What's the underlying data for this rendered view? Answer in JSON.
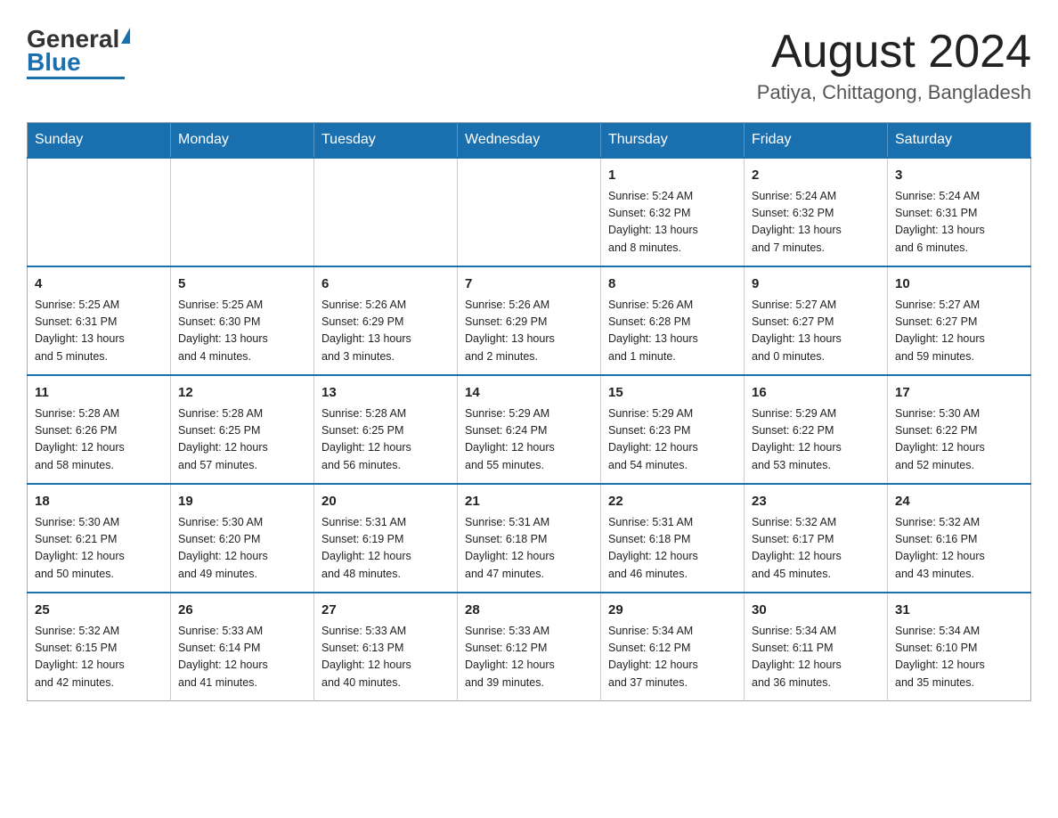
{
  "header": {
    "logo_general": "General",
    "logo_blue": "Blue",
    "month_title": "August 2024",
    "location": "Patiya, Chittagong, Bangladesh"
  },
  "weekdays": [
    "Sunday",
    "Monday",
    "Tuesday",
    "Wednesday",
    "Thursday",
    "Friday",
    "Saturday"
  ],
  "weeks": [
    [
      {
        "day": "",
        "info": ""
      },
      {
        "day": "",
        "info": ""
      },
      {
        "day": "",
        "info": ""
      },
      {
        "day": "",
        "info": ""
      },
      {
        "day": "1",
        "info": "Sunrise: 5:24 AM\nSunset: 6:32 PM\nDaylight: 13 hours\nand 8 minutes."
      },
      {
        "day": "2",
        "info": "Sunrise: 5:24 AM\nSunset: 6:32 PM\nDaylight: 13 hours\nand 7 minutes."
      },
      {
        "day": "3",
        "info": "Sunrise: 5:24 AM\nSunset: 6:31 PM\nDaylight: 13 hours\nand 6 minutes."
      }
    ],
    [
      {
        "day": "4",
        "info": "Sunrise: 5:25 AM\nSunset: 6:31 PM\nDaylight: 13 hours\nand 5 minutes."
      },
      {
        "day": "5",
        "info": "Sunrise: 5:25 AM\nSunset: 6:30 PM\nDaylight: 13 hours\nand 4 minutes."
      },
      {
        "day": "6",
        "info": "Sunrise: 5:26 AM\nSunset: 6:29 PM\nDaylight: 13 hours\nand 3 minutes."
      },
      {
        "day": "7",
        "info": "Sunrise: 5:26 AM\nSunset: 6:29 PM\nDaylight: 13 hours\nand 2 minutes."
      },
      {
        "day": "8",
        "info": "Sunrise: 5:26 AM\nSunset: 6:28 PM\nDaylight: 13 hours\nand 1 minute."
      },
      {
        "day": "9",
        "info": "Sunrise: 5:27 AM\nSunset: 6:27 PM\nDaylight: 13 hours\nand 0 minutes."
      },
      {
        "day": "10",
        "info": "Sunrise: 5:27 AM\nSunset: 6:27 PM\nDaylight: 12 hours\nand 59 minutes."
      }
    ],
    [
      {
        "day": "11",
        "info": "Sunrise: 5:28 AM\nSunset: 6:26 PM\nDaylight: 12 hours\nand 58 minutes."
      },
      {
        "day": "12",
        "info": "Sunrise: 5:28 AM\nSunset: 6:25 PM\nDaylight: 12 hours\nand 57 minutes."
      },
      {
        "day": "13",
        "info": "Sunrise: 5:28 AM\nSunset: 6:25 PM\nDaylight: 12 hours\nand 56 minutes."
      },
      {
        "day": "14",
        "info": "Sunrise: 5:29 AM\nSunset: 6:24 PM\nDaylight: 12 hours\nand 55 minutes."
      },
      {
        "day": "15",
        "info": "Sunrise: 5:29 AM\nSunset: 6:23 PM\nDaylight: 12 hours\nand 54 minutes."
      },
      {
        "day": "16",
        "info": "Sunrise: 5:29 AM\nSunset: 6:22 PM\nDaylight: 12 hours\nand 53 minutes."
      },
      {
        "day": "17",
        "info": "Sunrise: 5:30 AM\nSunset: 6:22 PM\nDaylight: 12 hours\nand 52 minutes."
      }
    ],
    [
      {
        "day": "18",
        "info": "Sunrise: 5:30 AM\nSunset: 6:21 PM\nDaylight: 12 hours\nand 50 minutes."
      },
      {
        "day": "19",
        "info": "Sunrise: 5:30 AM\nSunset: 6:20 PM\nDaylight: 12 hours\nand 49 minutes."
      },
      {
        "day": "20",
        "info": "Sunrise: 5:31 AM\nSunset: 6:19 PM\nDaylight: 12 hours\nand 48 minutes."
      },
      {
        "day": "21",
        "info": "Sunrise: 5:31 AM\nSunset: 6:18 PM\nDaylight: 12 hours\nand 47 minutes."
      },
      {
        "day": "22",
        "info": "Sunrise: 5:31 AM\nSunset: 6:18 PM\nDaylight: 12 hours\nand 46 minutes."
      },
      {
        "day": "23",
        "info": "Sunrise: 5:32 AM\nSunset: 6:17 PM\nDaylight: 12 hours\nand 45 minutes."
      },
      {
        "day": "24",
        "info": "Sunrise: 5:32 AM\nSunset: 6:16 PM\nDaylight: 12 hours\nand 43 minutes."
      }
    ],
    [
      {
        "day": "25",
        "info": "Sunrise: 5:32 AM\nSunset: 6:15 PM\nDaylight: 12 hours\nand 42 minutes."
      },
      {
        "day": "26",
        "info": "Sunrise: 5:33 AM\nSunset: 6:14 PM\nDaylight: 12 hours\nand 41 minutes."
      },
      {
        "day": "27",
        "info": "Sunrise: 5:33 AM\nSunset: 6:13 PM\nDaylight: 12 hours\nand 40 minutes."
      },
      {
        "day": "28",
        "info": "Sunrise: 5:33 AM\nSunset: 6:12 PM\nDaylight: 12 hours\nand 39 minutes."
      },
      {
        "day": "29",
        "info": "Sunrise: 5:34 AM\nSunset: 6:12 PM\nDaylight: 12 hours\nand 37 minutes."
      },
      {
        "day": "30",
        "info": "Sunrise: 5:34 AM\nSunset: 6:11 PM\nDaylight: 12 hours\nand 36 minutes."
      },
      {
        "day": "31",
        "info": "Sunrise: 5:34 AM\nSunset: 6:10 PM\nDaylight: 12 hours\nand 35 minutes."
      }
    ]
  ]
}
